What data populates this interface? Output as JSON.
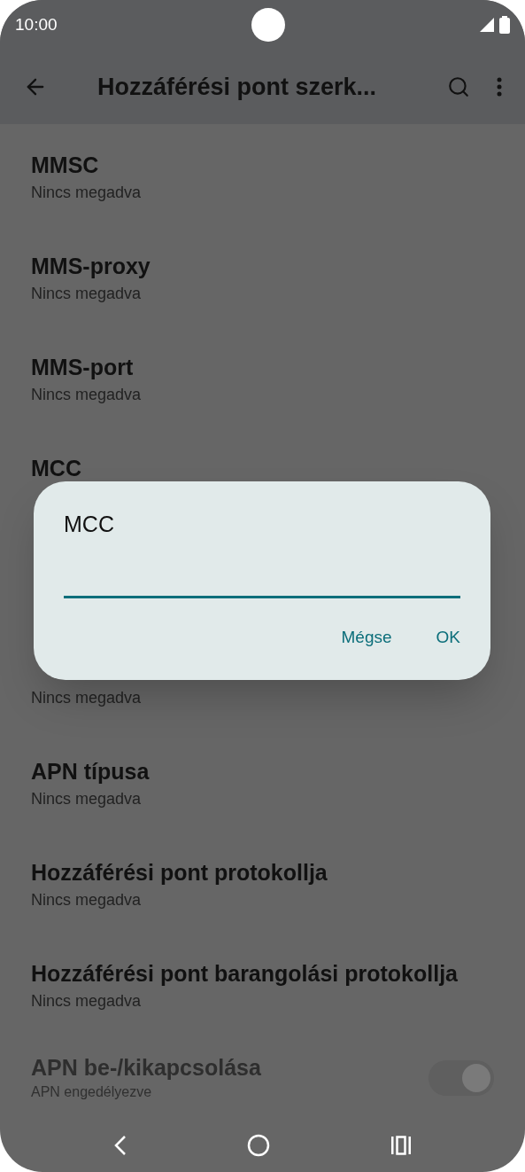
{
  "status_bar": {
    "time": "10:00"
  },
  "app_bar": {
    "title": "Hozzáférési pont szerk..."
  },
  "items": [
    {
      "title": "MMSC",
      "subtitle": "Nincs megadva"
    },
    {
      "title": "MMS-proxy",
      "subtitle": "Nincs megadva"
    },
    {
      "title": "MMS-port",
      "subtitle": "Nincs megadva"
    },
    {
      "title": "MCC"
    },
    {
      "subtitle": "Nincs megadva"
    },
    {
      "title": "APN típusa",
      "subtitle": "Nincs megadva"
    },
    {
      "title": "Hozzáférési pont protokollja",
      "subtitle": "Nincs megadva"
    },
    {
      "title": "Hozzáférési pont barangolási protokollja",
      "subtitle": "Nincs megadva"
    }
  ],
  "toggle_item": {
    "title": "APN be-/kikapcsolása",
    "subtitle": "APN engedélyezve",
    "on": true,
    "disabled": true
  },
  "dialog": {
    "title": "MCC",
    "buttons": [
      "Mégse",
      "OK"
    ]
  }
}
